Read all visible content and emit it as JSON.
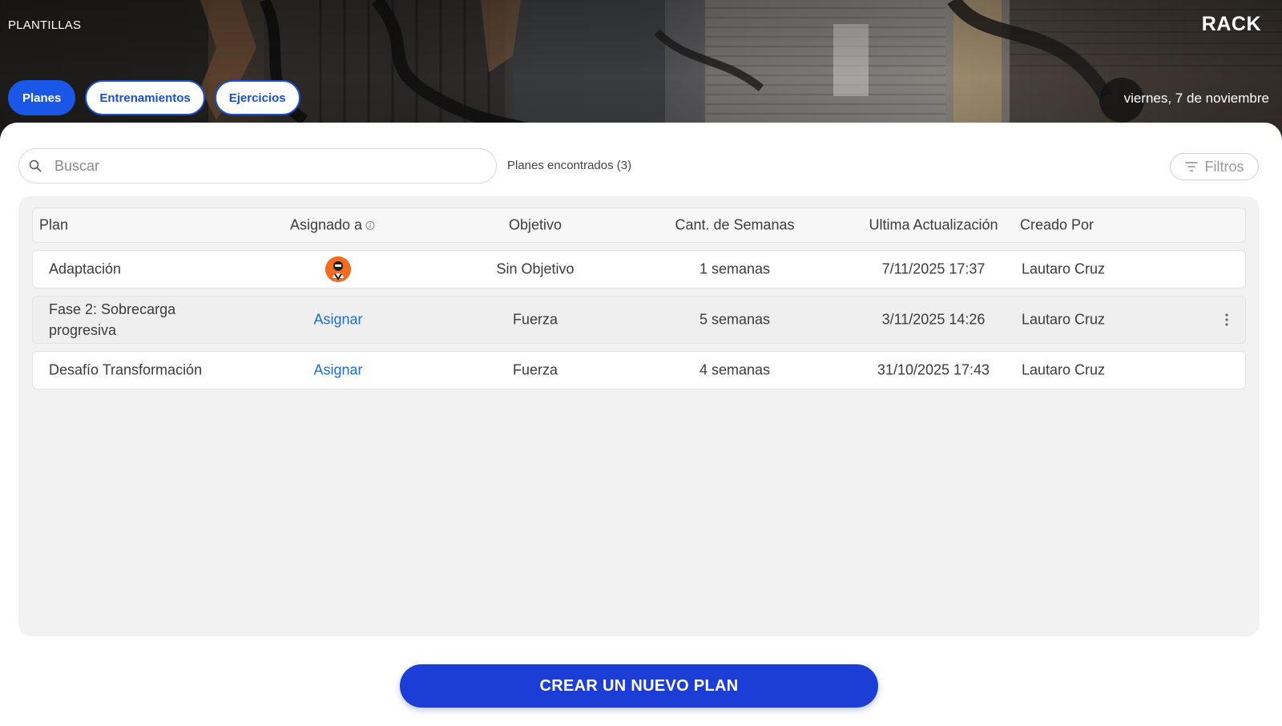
{
  "header": {
    "section_title": "PLANTILLAS",
    "brand": "RACK",
    "date": "viernes, 7 de noviembre",
    "tabs": [
      {
        "label": "Planes",
        "active": true
      },
      {
        "label": "Entrenamientos",
        "active": false
      },
      {
        "label": "Ejercicios",
        "active": false
      }
    ]
  },
  "toolbar": {
    "search_placeholder": "Buscar",
    "search_value": "",
    "found_text": "Planes encontrados (3)",
    "filters_label": "Filtros"
  },
  "table": {
    "columns": [
      "Plan",
      "Asignado a",
      "Objetivo",
      "Cant. de Semanas",
      "Ultima Actualización",
      "Creado Por"
    ],
    "rows": [
      {
        "plan": "Adaptación",
        "assigned": "",
        "objective": "Sin Objetivo",
        "weeks": "1 semanas",
        "updated": "7/11/2025 17:37",
        "creator": "Lautaro Cruz"
      },
      {
        "plan": "Fase 2: Sobrecarga progresiva",
        "assigned": "Asignar",
        "objective": "Fuerza",
        "weeks": "5 semanas",
        "updated": "3/11/2025 14:26",
        "creator": "Lautaro Cruz"
      },
      {
        "plan": "Desafío Transformación",
        "assigned": "Asignar",
        "objective": "Fuerza",
        "weeks": "4 semanas",
        "updated": "31/10/2025 17:43",
        "creator": "Lautaro Cruz"
      }
    ]
  },
  "cta": {
    "label": "CREAR UN NUEVO PLAN"
  },
  "colors": {
    "primary": "#1a57e6",
    "cta": "#1c3ed6",
    "link": "#1a6fe0",
    "panel": "#f2f2f2",
    "avatar": "#f36b21"
  },
  "icons": {
    "search": "search-icon",
    "filter": "filter-icon",
    "info": "info-icon",
    "menu": "more-vertical-icon"
  }
}
